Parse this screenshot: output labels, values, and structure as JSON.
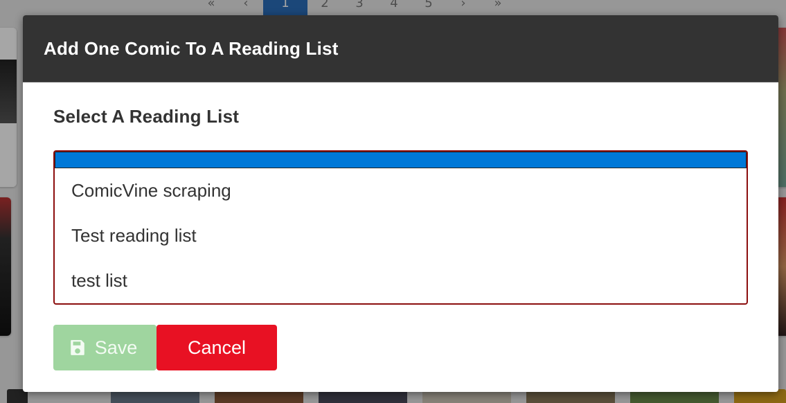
{
  "background": {
    "pager": [
      "«",
      "‹",
      "1",
      "2",
      "3",
      "4",
      "5",
      "›",
      "»"
    ]
  },
  "modal": {
    "title": "Add One Comic To A Reading List",
    "field_label": "Select A Reading List",
    "options": [
      {
        "label": "",
        "selected": true
      },
      {
        "label": "ComicVine scraping",
        "selected": false
      },
      {
        "label": "Test reading list",
        "selected": false
      },
      {
        "label": "test list",
        "selected": false
      }
    ],
    "save_label": "Save",
    "cancel_label": "Cancel",
    "colors": {
      "header_bg": "#333333",
      "selection": "#0078d7",
      "save_bg": "#9fd59f",
      "cancel_bg": "#e81123",
      "listbox_border": "#8b0d0d"
    }
  }
}
